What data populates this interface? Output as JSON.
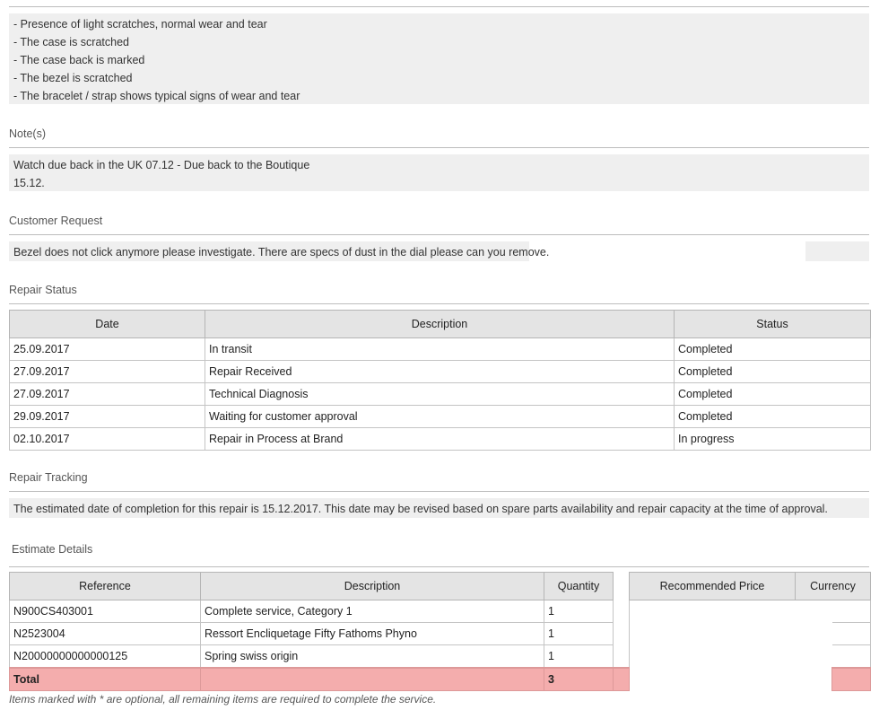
{
  "condition": {
    "lines": [
      "- Presence of light scratches, normal wear and tear",
      "- The case is scratched",
      "- The case back is marked",
      "- The bezel is scratched",
      "- The bracelet / strap shows typical signs of wear and tear"
    ]
  },
  "notes": {
    "title": "Note(s)",
    "lines": [
      "Watch due back in the UK 07.12 - Due back to the Boutique",
      "15.12."
    ]
  },
  "customer_request": {
    "title": "Customer Request",
    "text": "Bezel does not click anymore please investigate. There are specs of dust in the dial please can you remove."
  },
  "repair_status": {
    "title": "Repair Status",
    "headers": [
      "Date",
      "Description",
      "Status"
    ],
    "rows": [
      [
        "25.09.2017",
        "In transit",
        "Completed"
      ],
      [
        "27.09.2017",
        "Repair Received",
        "Completed"
      ],
      [
        "27.09.2017",
        "Technical Diagnosis",
        "Completed"
      ],
      [
        "29.09.2017",
        "Waiting for customer approval",
        "Completed"
      ],
      [
        "02.10.2017",
        "Repair in Process at Brand",
        "In progress"
      ]
    ]
  },
  "repair_tracking": {
    "title": "Repair Tracking",
    "text": "The estimated date of completion for this repair is 15.12.2017. This date may be revised based on spare parts availability and repair capacity at the time of approval."
  },
  "estimate": {
    "title": "Estimate Details",
    "headers": [
      "Reference",
      "Description",
      "Quantity",
      "Recommended Price",
      "Currency"
    ],
    "rows": [
      [
        "N900CS403001",
        "Complete service, Category 1",
        "1"
      ],
      [
        "N2523004",
        "Ressort Encliquetage Fifty Fathoms Phyno",
        "1"
      ],
      [
        "N20000000000000125",
        "Spring swiss origin",
        "1"
      ]
    ],
    "total_label": "Total",
    "total_quantity": "3",
    "footnote": "Items marked with * are optional, all remaining items are required to complete the service."
  }
}
